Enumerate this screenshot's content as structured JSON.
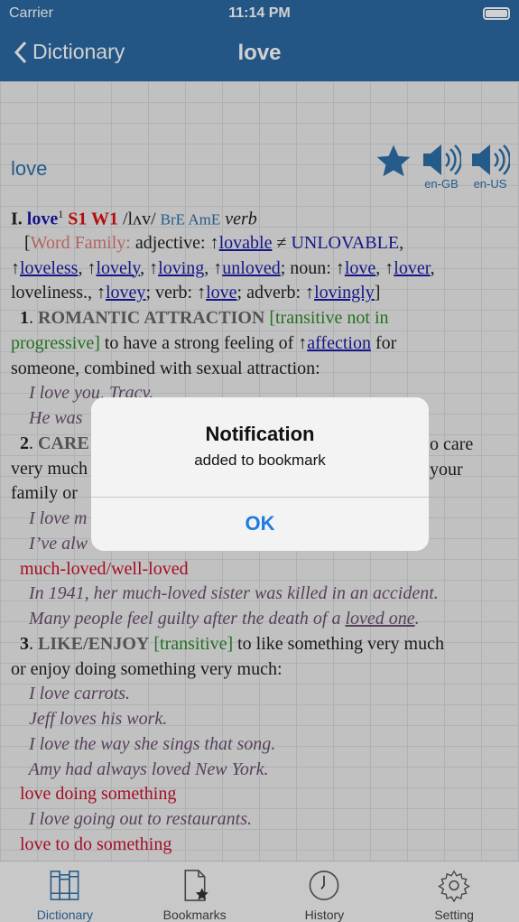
{
  "status": {
    "carrier": "Carrier",
    "time": "11:14 PM"
  },
  "nav": {
    "back": "Dictionary",
    "title": "love"
  },
  "entry": {
    "headword": "love",
    "audio": [
      {
        "label": "en-GB"
      },
      {
        "label": "en-US"
      }
    ],
    "lines": [
      [
        [
          "I. ",
          "bold"
        ],
        [
          "love",
          "blue bold"
        ],
        [
          "1",
          "sup"
        ],
        [
          " S1 W1",
          "red bold"
        ],
        [
          " /lʌv/ ",
          ""
        ],
        [
          "BrE AmE",
          "gray"
        ],
        [
          " verb",
          "it"
        ]
      ],
      [
        [
          "   [",
          ""
        ],
        [
          "Word Family:",
          "pink"
        ],
        [
          " adjective: ↑",
          ""
        ],
        [
          "lovable",
          "link"
        ],
        [
          " ≠ ",
          ""
        ],
        [
          "UNLOVABLE",
          "blue"
        ],
        [
          ",",
          ""
        ]
      ],
      [
        [
          "↑",
          ""
        ],
        [
          "loveless",
          "link"
        ],
        [
          ", ↑",
          ""
        ],
        [
          "lovely",
          "link"
        ],
        [
          ", ↑",
          ""
        ],
        [
          "loving",
          "link"
        ],
        [
          ", ↑",
          ""
        ],
        [
          "unloved",
          "link"
        ],
        [
          "; noun: ↑",
          ""
        ],
        [
          "love",
          "link"
        ],
        [
          ", ↑",
          ""
        ],
        [
          "lover",
          "link"
        ],
        [
          ",",
          ""
        ]
      ],
      [
        [
          "loveliness., ↑",
          ""
        ],
        [
          "lovey",
          "link"
        ],
        [
          "; verb: ↑",
          ""
        ],
        [
          "love",
          "link"
        ],
        [
          "; adverb: ↑",
          ""
        ],
        [
          "lovingly",
          "link"
        ],
        [
          "]",
          ""
        ]
      ],
      [
        [
          "  1",
          "num"
        ],
        [
          ". ",
          ""
        ],
        [
          "ROMANTIC ATTRACTION",
          "sense"
        ],
        [
          " [transitive not in",
          "green"
        ]
      ],
      [
        [
          "progressive]",
          "green"
        ],
        [
          " to have a strong feeling of ↑",
          ""
        ],
        [
          "affection",
          "link"
        ],
        [
          " for",
          ""
        ]
      ],
      [
        [
          "someone, combined with sexual attraction:",
          ""
        ]
      ],
      [
        [
          "    I love you, Tracy.",
          "ex"
        ]
      ],
      [
        [
          "    He was",
          "ex"
        ]
      ],
      [
        [
          "  2",
          "num"
        ],
        [
          ". ",
          ""
        ],
        [
          "CARE",
          "sense"
        ]
      ],
      [
        [
          "very much",
          ""
        ]
      ],
      [
        [
          "family or",
          ""
        ]
      ],
      [
        [
          "    I love m",
          "ex"
        ]
      ],
      [
        [
          "    I’ve alw",
          "ex"
        ]
      ],
      [
        [
          "  much-loved/well-loved",
          "phr"
        ]
      ],
      [
        [
          "    In 1941, her much-loved sister was killed in an accident.",
          "ex"
        ]
      ],
      [
        [
          "    Many people feel guilty after the death of a ",
          "ex"
        ],
        [
          "loved one",
          "ex ul"
        ],
        [
          ".",
          "ex"
        ]
      ],
      [
        [
          "  3",
          "num"
        ],
        [
          ". ",
          ""
        ],
        [
          "LIKE/ENJOY",
          "sense"
        ],
        [
          " [transitive]",
          "green"
        ],
        [
          " to like something very much",
          ""
        ]
      ],
      [
        [
          "or enjoy doing something very much:",
          ""
        ]
      ],
      [
        [
          "    I love carrots.",
          "ex"
        ]
      ],
      [
        [
          "    Jeff loves his work.",
          "ex"
        ]
      ],
      [
        [
          "    I love the way she sings that song.",
          "ex"
        ]
      ],
      [
        [
          "    Amy had always loved New York.",
          "ex"
        ]
      ],
      [
        [
          "  love doing something",
          "phr"
        ]
      ],
      [
        [
          "    I love going out to restaurants.",
          "ex"
        ]
      ],
      [
        [
          "  love to do something",
          "phr"
        ]
      ]
    ],
    "right_fragments": [
      "o care",
      "your"
    ]
  },
  "dialog": {
    "title": "Notification",
    "message": "added to bookmark",
    "ok": "OK"
  },
  "tabs": [
    {
      "label": "Dictionary",
      "icon": "books-icon",
      "active": true
    },
    {
      "label": "Bookmarks",
      "icon": "bookmark-document-icon"
    },
    {
      "label": "History",
      "icon": "clock-icon"
    },
    {
      "label": "Setting",
      "icon": "gear-icon"
    }
  ],
  "colors": {
    "nav": "#2b6aa3",
    "accent": "#2e6fa7",
    "link": "#1a1aa8",
    "ok": "#1f7ae0"
  }
}
